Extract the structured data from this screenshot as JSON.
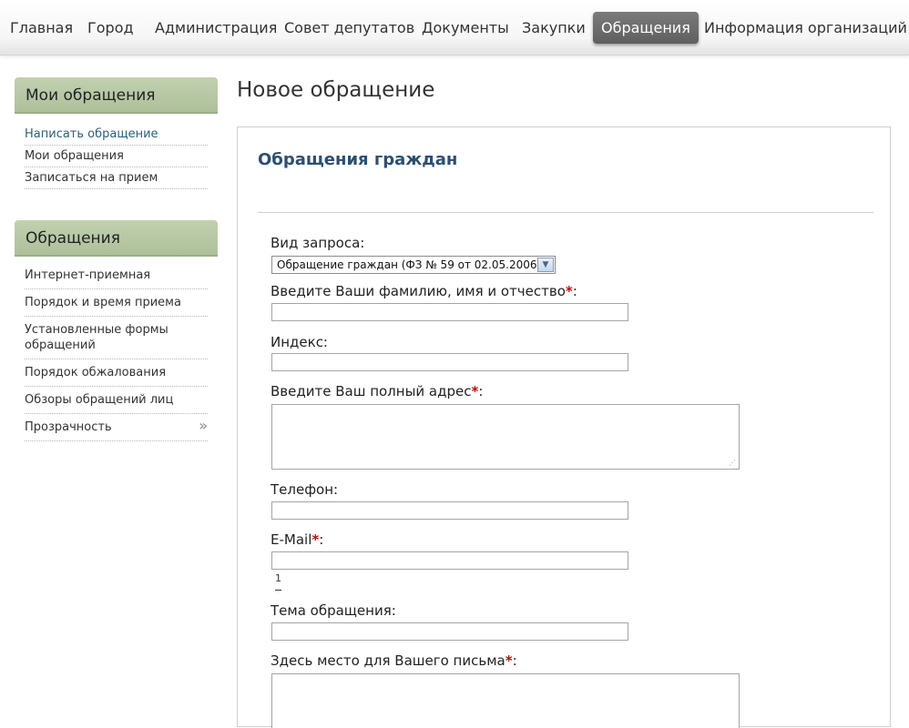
{
  "nav": {
    "items": [
      {
        "label": "Главная",
        "active": false
      },
      {
        "label": "Город",
        "active": false
      },
      {
        "label": "Администрация",
        "active": false
      },
      {
        "label": "Совет депутатов",
        "active": false
      },
      {
        "label": "Документы",
        "active": false
      },
      {
        "label": "Закупки",
        "active": false
      },
      {
        "label": "Обращения",
        "active": true
      },
      {
        "label": "Информация организаций",
        "active": false
      }
    ]
  },
  "sidebar": {
    "block1": {
      "title": "Мои обращения",
      "items": [
        "Написать обращение",
        "Мои обращения",
        "Записаться на прием"
      ]
    },
    "block2": {
      "title": "Обращения",
      "items": [
        "Интернет-приемная",
        "Порядок и время приема",
        "Установленные формы обращений",
        "Порядок обжалования",
        "Обзоры обращений лиц",
        "Прозрачность"
      ]
    }
  },
  "main": {
    "page_title": "Новое обращение",
    "section_title": "Обращения граждан"
  },
  "form": {
    "request_type_label": "Вид запроса:",
    "request_type_value": "Обращение граждан (ФЗ № 59 от 02.05.2006)",
    "fio_label": "Введите Ваши фамилию, имя и отчество",
    "index_label": "Индекс:",
    "address_label": "Введите Ваш полный адрес",
    "phone_label": "Телефон:",
    "email_label": "E-Mail",
    "counter": "1",
    "subject_label": "Тема обращения:",
    "letter_label": "Здесь место для Вашего письма",
    "required_mark": "*",
    "colon": ":"
  },
  "colors": {
    "accent": "#2b4f72",
    "sidebar_header": "#b6c6a3",
    "nav_active": "#6a6a6a",
    "required": "#cc0000"
  }
}
